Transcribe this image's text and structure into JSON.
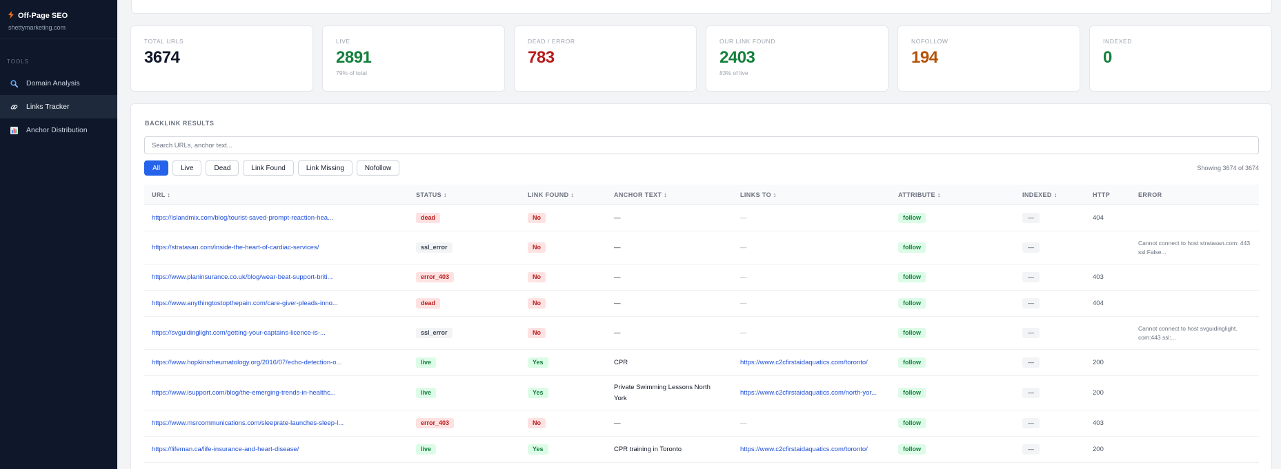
{
  "sidebar": {
    "brand_title": "Off-Page SEO",
    "brand_domain": "shettymarketing.com",
    "section_label": "TOOLS",
    "items": [
      {
        "label": "Domain Analysis",
        "icon": "magnifier-icon"
      },
      {
        "label": "Links Tracker",
        "icon": "link-icon"
      },
      {
        "label": "Anchor Distribution",
        "icon": "bar-chart-icon"
      }
    ]
  },
  "stats": [
    {
      "label": "TOTAL URLS",
      "value": "3674",
      "note": "",
      "color": "#0f172a"
    },
    {
      "label": "LIVE",
      "value": "2891",
      "note": "79% of total",
      "color": "#15803d"
    },
    {
      "label": "DEAD / ERROR",
      "value": "783",
      "note": "",
      "color": "#b91c1c"
    },
    {
      "label": "OUR LINK FOUND",
      "value": "2403",
      "note": "83% of live",
      "color": "#15803d"
    },
    {
      "label": "NOFOLLOW",
      "value": "194",
      "note": "",
      "color": "#b45309"
    },
    {
      "label": "INDEXED",
      "value": "0",
      "note": "",
      "color": "#15803d"
    }
  ],
  "results": {
    "title": "BACKLINK RESULTS",
    "search_placeholder": "Search URLs, anchor text...",
    "filters": [
      "All",
      "Live",
      "Dead",
      "Link Found",
      "Link Missing",
      "Nofollow"
    ],
    "showing": "Showing 3674 of 3674",
    "columns": [
      "URL ↕",
      "STATUS ↕",
      "LINK FOUND ↕",
      "ANCHOR TEXT ↕",
      "LINKS TO ↕",
      "ATTRIBUTE ↕",
      "INDEXED ↕",
      "HTTP",
      "ERROR"
    ],
    "rows": [
      {
        "url": "https://islandmix.com/blog/tourist-saved-prompt-reaction-hea...",
        "status": "dead",
        "found": "No",
        "anchor": "—",
        "links_to": "—",
        "attr": "follow",
        "indexed": "—",
        "http": "404",
        "error": ""
      },
      {
        "url": "https://stratasan.com/inside-the-heart-of-cardiac-services/",
        "status": "ssl_error",
        "found": "No",
        "anchor": "—",
        "links_to": "—",
        "attr": "follow",
        "indexed": "—",
        "http": "",
        "error": "Cannot connect to host stratasan.com: 443 ssl:False..."
      },
      {
        "url": "https://www.planinsurance.co.uk/blog/wear-beat-support-briti...",
        "status": "error_403",
        "found": "No",
        "anchor": "—",
        "links_to": "—",
        "attr": "follow",
        "indexed": "—",
        "http": "403",
        "error": ""
      },
      {
        "url": "https://www.anythingtostopthepain.com/care-giver-pleads-inno...",
        "status": "dead",
        "found": "No",
        "anchor": "—",
        "links_to": "—",
        "attr": "follow",
        "indexed": "—",
        "http": "404",
        "error": ""
      },
      {
        "url": "https://svguidinglight.com/getting-your-captains-licence-is-...",
        "status": "ssl_error",
        "found": "No",
        "anchor": "—",
        "links_to": "—",
        "attr": "follow",
        "indexed": "—",
        "http": "",
        "error": "Cannot connect to host svguidinglight. com:443 ssl:..."
      },
      {
        "url": "https://www.hopkinsrheumatology.org/2016/07/echo-detection-o...",
        "status": "live",
        "found": "Yes",
        "anchor": "CPR",
        "links_to": "https://www.c2cfirstaidaquatics.com/toronto/",
        "attr": "follow",
        "indexed": "—",
        "http": "200",
        "error": ""
      },
      {
        "url": "https://www.isupport.com/blog/the-emerging-trends-in-healthc...",
        "status": "live",
        "found": "Yes",
        "anchor": "Private Swimming Lessons North York",
        "links_to": "https://www.c2cfirstaidaquatics.com/north-yor...",
        "attr": "follow",
        "indexed": "—",
        "http": "200",
        "error": ""
      },
      {
        "url": "https://www.msrcommunications.com/sleeprate-launches-sleep-l...",
        "status": "error_403",
        "found": "No",
        "anchor": "—",
        "links_to": "—",
        "attr": "follow",
        "indexed": "—",
        "http": "403",
        "error": ""
      },
      {
        "url": "https://lifeman.ca/life-insurance-and-heart-disease/",
        "status": "live",
        "found": "Yes",
        "anchor": "CPR training in Toronto",
        "links_to": "https://www.c2cfirstaidaquatics.com/toronto/",
        "attr": "follow",
        "indexed": "—",
        "http": "200",
        "error": ""
      }
    ]
  }
}
